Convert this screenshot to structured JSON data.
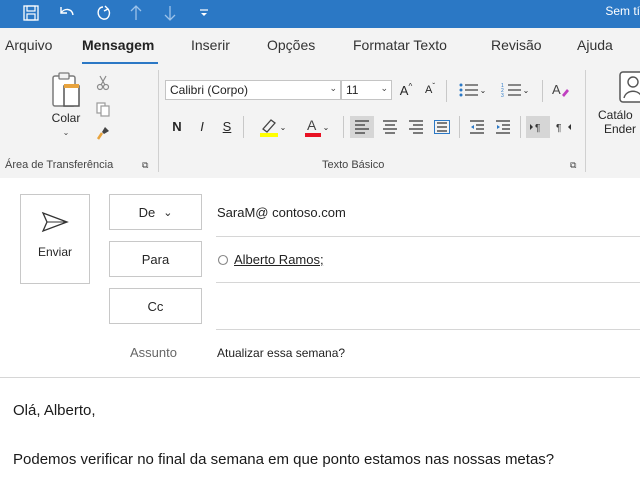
{
  "window": {
    "title": "Sem tí"
  },
  "tabs": [
    "Arquivo",
    "Mensagem",
    "Inserir",
    "Opções",
    "Formatar Texto",
    "Revisão",
    "Ajuda"
  ],
  "ribbon": {
    "clipboard": {
      "paste_label": "Colar",
      "group_label": "Área de Transferência"
    },
    "basic_text": {
      "font_name": "Calibri (Corpo)",
      "font_size": "11",
      "group_label": "Texto Básico",
      "bold": "N",
      "italic": "I",
      "underline": "S",
      "grow": "A",
      "shrink": "A"
    },
    "names": {
      "label_line1": "Catálo",
      "label_line2": "Ender"
    }
  },
  "colors": {
    "accent": "#2b78c5",
    "highlight": "#ffff00",
    "font_color": "#e81123"
  },
  "compose": {
    "send_label": "Enviar",
    "from_label": "De",
    "from_value": "SaraM@ contoso.com",
    "to_label": "Para",
    "to_value": "Alberto Ramos;",
    "cc_label": "Cc",
    "subject_label": "Assunto",
    "subject_value": "Atualizar essa semana?"
  },
  "body": {
    "line1": "Olá, Alberto,",
    "line2": "Podemos verificar no final da semana em que ponto estamos nas nossas metas?"
  }
}
